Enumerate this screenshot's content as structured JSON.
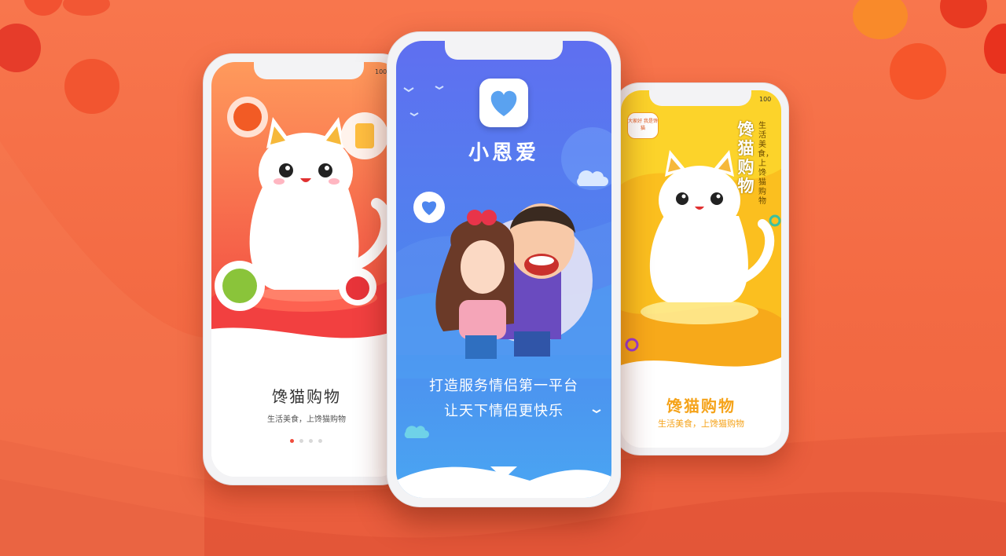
{
  "left_screen": {
    "status_text": "100",
    "title": "馋猫购物",
    "subtitle": "生活美食，上馋猫购物",
    "page_dots": {
      "count": 4,
      "active_index": 0
    }
  },
  "center_screen": {
    "app_icon": "heart-icon",
    "app_name": "小恩爱",
    "slogan_line1": "打造服务情侣第一平台",
    "slogan_line2": "让天下情侣更快乐",
    "next_icon": "chevron-down-icon"
  },
  "right_screen": {
    "status_text": "100",
    "speech_bubble": "大家好 我是馋猫",
    "vertical_title": "馋猫购物",
    "vertical_subtitle": "生活美食，上馋猫购物",
    "title": "馋猫购物",
    "subtitle": "生活美食，上馋猫购物"
  },
  "colors": {
    "background": "#f56b43",
    "left_accent": "#f04c3c",
    "center_accent": "#4d86ee",
    "right_accent": "#f5c518"
  }
}
